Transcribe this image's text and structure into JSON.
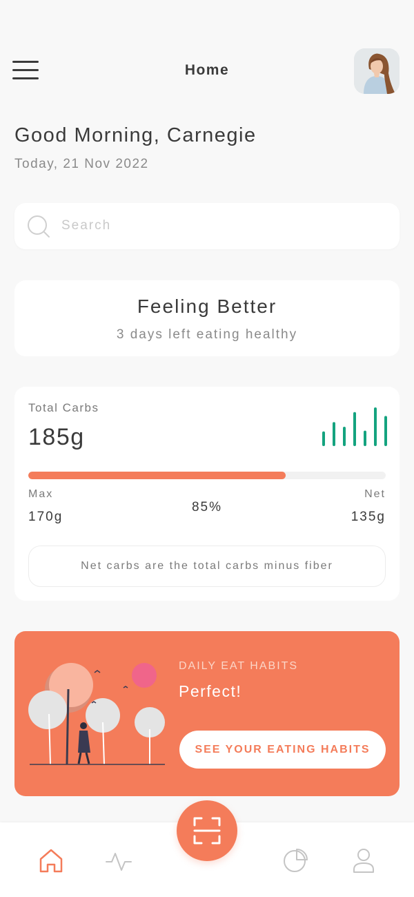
{
  "header": {
    "title": "Home",
    "menu_icon": "hamburger-menu-icon",
    "avatar_icon": "user-avatar"
  },
  "greeting": {
    "text": "Good Morning, Carnegie",
    "date": "Today, 21 Nov 2022"
  },
  "search": {
    "placeholder": "Search",
    "value": "",
    "icon": "search-icon"
  },
  "feeling": {
    "title": "Feeling Better",
    "subtitle": "3 days left eating healthy"
  },
  "carbs": {
    "label": "Total Carbs",
    "total": "185g",
    "progress_fraction": 0.72,
    "max_label": "Max",
    "max_value": "170g",
    "percent": "85%",
    "net_label": "Net",
    "net_value": "135g",
    "note": "Net carbs are the total carbs minus fiber",
    "mini_bars": [
      0.38,
      0.62,
      0.5,
      0.88,
      0.4,
      1.0,
      0.78
    ],
    "mini_bar_color": "#14a37f"
  },
  "habits": {
    "kicker": "DAILY EAT HABITS",
    "headline": "Perfect!",
    "cta": "SEE YOUR EATING HABITS",
    "background": "#f47c5a"
  },
  "bottom_nav": {
    "items": [
      {
        "icon": "home-icon",
        "active": true
      },
      {
        "icon": "activity-icon",
        "active": false
      },
      {
        "icon": "scan-icon",
        "active": false
      },
      {
        "icon": "pie-chart-icon",
        "active": false
      },
      {
        "icon": "profile-icon",
        "active": false
      }
    ],
    "active_color": "#f47c5a",
    "inactive_color": "#c4c4c4"
  }
}
